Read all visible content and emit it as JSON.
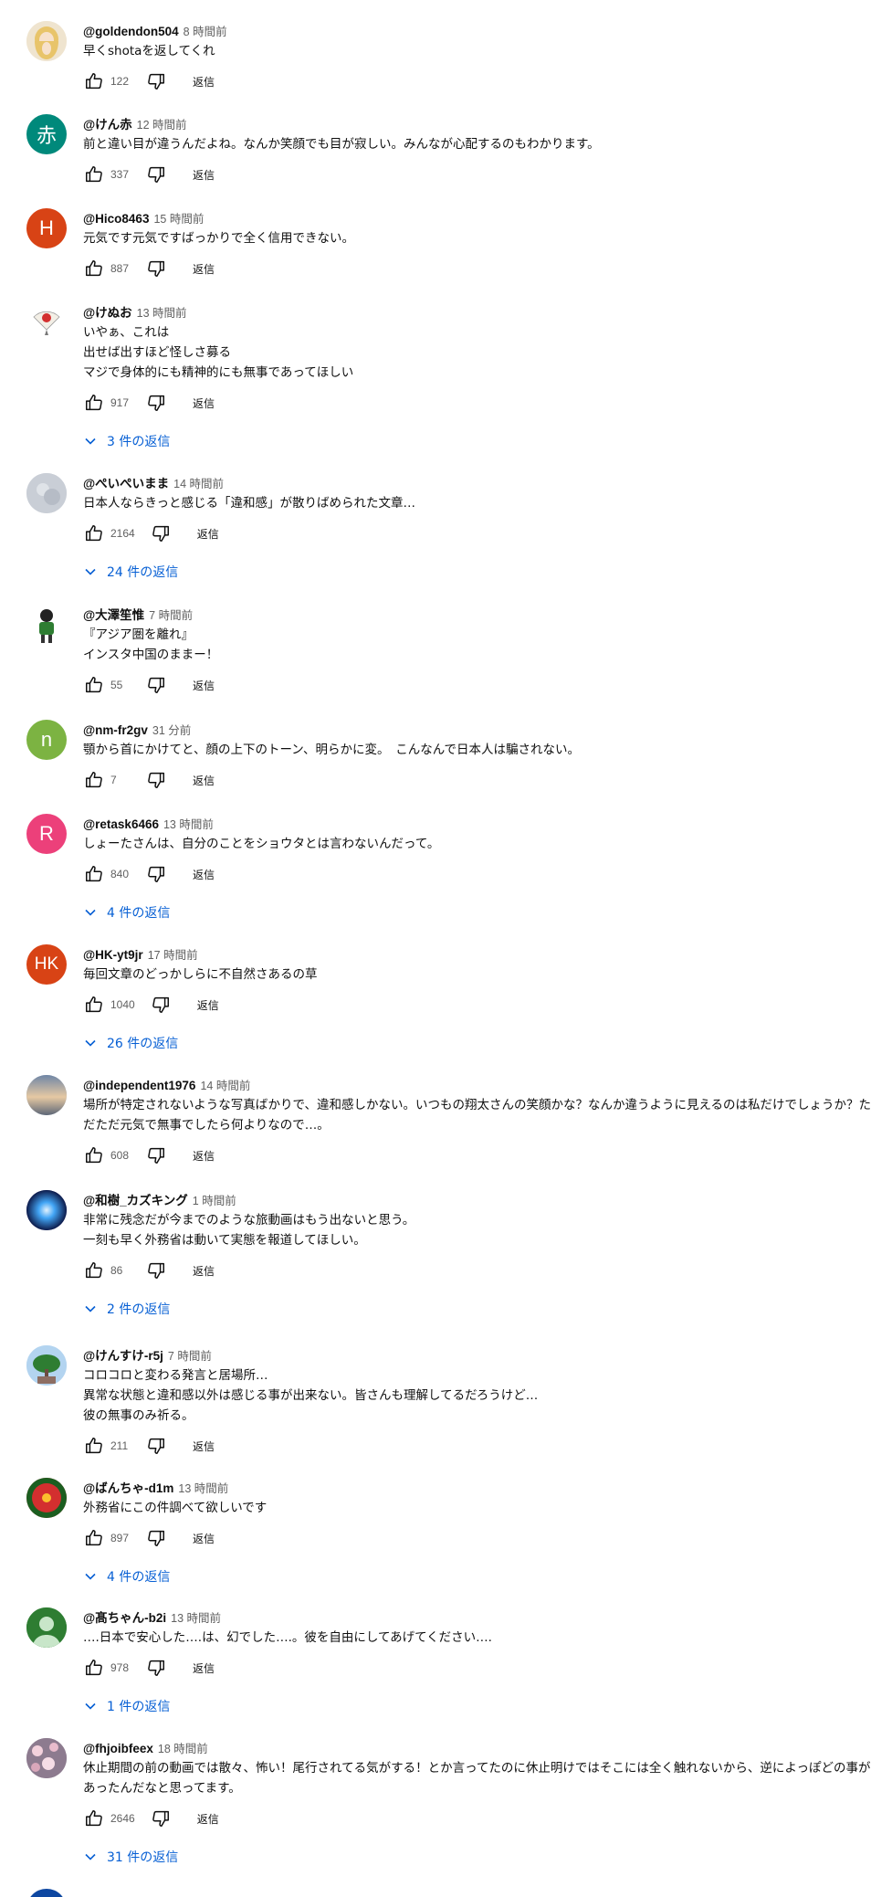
{
  "comments": [
    {
      "author": "@goldendon504",
      "time": "8 時間前",
      "text": "早くshotaを返してくれ",
      "likes": "122",
      "reply": "返信",
      "replies": "",
      "avatar": {
        "type": "blonde",
        "letter": "",
        "bg": "#f0e6d2"
      }
    },
    {
      "author": "@けん赤",
      "time": "12 時間前",
      "text": "前と違い目が違うんだよね。なんか笑顔でも目が寂しい。みんなが心配するのもわかります。",
      "likes": "337",
      "reply": "返信",
      "replies": "",
      "avatar": {
        "type": "letter",
        "letter": "赤",
        "bg": "#00897b"
      }
    },
    {
      "author": "@Hico8463",
      "time": "15 時間前",
      "text": "元気です元気ですばっかりで全く信用できない。",
      "likes": "887",
      "reply": "返信",
      "replies": "",
      "avatar": {
        "type": "letter",
        "letter": "H",
        "bg": "#d84315"
      }
    },
    {
      "author": "@けぬお",
      "time": "13 時間前",
      "text": "いやぁ、これは\n出せば出すほど怪しさ募る\nマジで身体的にも精神的にも無事であってほしい",
      "likes": "917",
      "reply": "返信",
      "replies": "3 件の返信",
      "avatar": {
        "type": "fan",
        "letter": "",
        "bg": "#ffffff"
      }
    },
    {
      "author": "@ぺいぺいまま",
      "time": "14 時間前",
      "text": "日本人ならきっと感じる「違和感」が散りばめられた文章…",
      "likes": "2164",
      "reply": "返信",
      "replies": "24 件の返信",
      "avatar": {
        "type": "grey",
        "letter": "",
        "bg": "#c9ced6"
      }
    },
    {
      "author": "@大澤笙惟",
      "time": "7 時間前",
      "text": "『アジア圏を離れ』\nインスタ中国のままー！",
      "likes": "55",
      "reply": "返信",
      "replies": "",
      "avatar": {
        "type": "figure",
        "letter": "",
        "bg": "#ffffff"
      }
    },
    {
      "author": "@nm-fr2gv",
      "time": "31 分前",
      "text": "顎から首にかけてと、顔の上下のトーン、明らかに変。　こんなんで日本人は騙されない。",
      "likes": "7",
      "reply": "返信",
      "replies": "",
      "avatar": {
        "type": "letter",
        "letter": "n",
        "bg": "#7cb342"
      }
    },
    {
      "author": "@retask6466",
      "time": "13 時間前",
      "text": "しょーたさんは、自分のことをショウタとは言わないんだって。",
      "likes": "840",
      "reply": "返信",
      "replies": "4 件の返信",
      "avatar": {
        "type": "letter",
        "letter": "R",
        "bg": "#ec407a"
      }
    },
    {
      "author": "@HK-yt9jr",
      "time": "17 時間前",
      "text": "毎回文章のどっかしらに不自然さあるの草",
      "likes": "1040",
      "reply": "返信",
      "replies": "26 件の返信",
      "avatar": {
        "type": "letter",
        "letter": "HK",
        "bg": "#d84315"
      }
    },
    {
      "author": "@independent1976",
      "time": "14 時間前",
      "text": "場所が特定されないような写真ばかりで、違和感しかない。いつもの翔太さんの笑顔かな？なんか違うように見えるのは私だけでしょうか？ただただ元気で無事でしたら何よりなので…。",
      "likes": "608",
      "reply": "返信",
      "replies": "",
      "avatar": {
        "type": "sky",
        "letter": "",
        "bg": "#8a9bb0"
      }
    },
    {
      "author": "@和樹_カズキング",
      "time": "1 時間前",
      "text": "非常に残念だが今までのような旅動画はもう出ないと思う。\n一刻も早く外務省は動いて実態を報道してほしい。",
      "likes": "86",
      "reply": "返信",
      "replies": "2 件の返信",
      "avatar": {
        "type": "glow",
        "letter": "",
        "bg": "#1a237e"
      }
    },
    {
      "author": "@けんすけ-r5j",
      "time": "7 時間前",
      "text": "コロコロと変わる発言と居場所…\n異常な状態と違和感以外は感じる事が出来ない。皆さんも理解してるだろうけど…\n彼の無事のみ祈る。",
      "likes": "211",
      "reply": "返信",
      "replies": "",
      "avatar": {
        "type": "tree",
        "letter": "",
        "bg": "#b3d4f0"
      }
    },
    {
      "author": "@ばんちゃ-d1m",
      "time": "13 時間前",
      "text": "外務省にこの件調べて欲しいです",
      "likes": "897",
      "reply": "返信",
      "replies": "4 件の返信",
      "avatar": {
        "type": "flower",
        "letter": "",
        "bg": "#c62828"
      }
    },
    {
      "author": "@髙ちゃん-b2i",
      "time": "13 時間前",
      "text": "….日本で安心した….は、幻でした….。彼を自由にしてあげてください….",
      "likes": "978",
      "reply": "返信",
      "replies": "1 件の返信",
      "avatar": {
        "type": "person",
        "letter": "",
        "bg": "#2e7d32"
      }
    },
    {
      "author": "@fhjoibfeex",
      "time": "18 時間前",
      "text": "休止期間の前の動画では散々、怖い！尾行されてる気がする！とか言ってたのに休止明けではそこには全く触れないから、逆によっぽどの事があったんだなと思ってます。",
      "likes": "2646",
      "reply": "返信",
      "replies": "31 件の返信",
      "avatar": {
        "type": "blossom",
        "letter": "",
        "bg": "#8d7b8f"
      }
    }
  ]
}
